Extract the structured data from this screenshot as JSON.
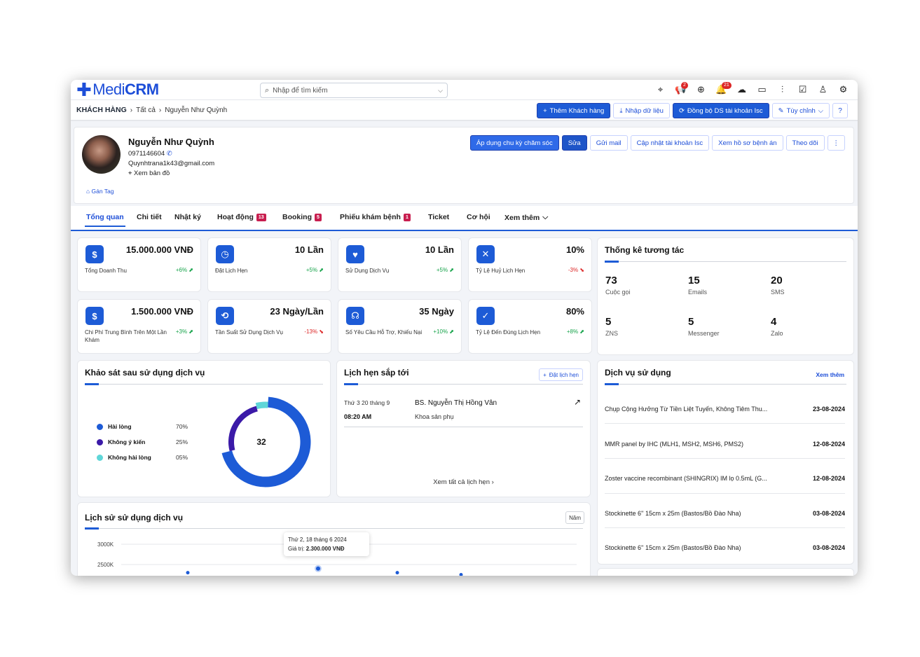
{
  "brand": {
    "logo_text_a": "Medi",
    "logo_text_b": "CRM",
    "accent": "#1d5bd6"
  },
  "search": {
    "placeholder": "Nhập để tìm kiếm"
  },
  "top_icons": [
    {
      "name": "location-icon",
      "badge": ""
    },
    {
      "name": "megaphone-icon",
      "badge": "2"
    },
    {
      "name": "plus-circle-icon",
      "badge": ""
    },
    {
      "name": "bell-icon",
      "badge": "21"
    },
    {
      "name": "cloud-icon",
      "badge": ""
    },
    {
      "name": "calendar-icon",
      "badge": ""
    },
    {
      "name": "chart-icon",
      "badge": ""
    },
    {
      "name": "checkbox-icon",
      "badge": ""
    },
    {
      "name": "user-icon",
      "badge": ""
    },
    {
      "name": "settings-icon",
      "badge": ""
    }
  ],
  "breadcrumb": {
    "root": "KHÁCH HÀNG",
    "level1": "Tất cả",
    "level2": "Nguyễn Như Quỳnh"
  },
  "subbar_actions": {
    "add": "Thêm Khách hàng",
    "import": "Nhập dữ liệu",
    "sync": "Đồng bộ DS tài khoản Isc",
    "custom": "Tùy chỉnh"
  },
  "profile": {
    "name": "Nguyễn Như Quỳnh",
    "phone": "0971146604",
    "email": "Quynhtrana1k43@gmail.com",
    "map": "Xem bản đồ",
    "tag": "Gán Tag",
    "actions": {
      "apply": "Áp dụng chu kỳ chăm sóc",
      "edit": "Sửa",
      "mail": "Gửi mail",
      "update": "Cập nhật tài khoản Isc",
      "records": "Xem hồ sơ bệnh án",
      "follow": "Theo dõi"
    }
  },
  "tabs": [
    {
      "label": "Tổng quan",
      "badge": ""
    },
    {
      "label": "Chi tiết",
      "badge": ""
    },
    {
      "label": "Nhật ký",
      "badge": ""
    },
    {
      "label": "Hoạt động",
      "badge": "13"
    },
    {
      "label": "Booking",
      "badge": "5"
    },
    {
      "label": "Phiếu khám bệnh",
      "badge": "1"
    },
    {
      "label": "Ticket",
      "badge": ""
    },
    {
      "label": "Cơ hội",
      "badge": ""
    },
    {
      "label": "Xem thêm",
      "badge": ""
    }
  ],
  "kpis": [
    {
      "icon": "money-bag-icon",
      "value": "15.000.000 VNĐ",
      "label": "Tổng Doanh Thu",
      "delta": "+6%",
      "dir": "up"
    },
    {
      "icon": "calendar-clock-icon",
      "value": "10 Lần",
      "label": "Đặt Lịch Hẹn",
      "delta": "+5%",
      "dir": "up"
    },
    {
      "icon": "heart-hand-icon",
      "value": "10 Lần",
      "label": "Sử Dụng Dịch Vụ",
      "delta": "+5%",
      "dir": "up"
    },
    {
      "icon": "calendar-x-icon",
      "value": "10%",
      "label": "Tỷ Lệ Huỷ Lịch Hẹn",
      "delta": "-3%",
      "dir": "down"
    },
    {
      "icon": "hand-coin-icon",
      "value": "1.500.000 VNĐ",
      "label": "Chi Phí Trung Bình Trên Một Lần Khám",
      "delta": "+3%",
      "dir": "up"
    },
    {
      "icon": "timer-icon",
      "value": "23 Ngày/Lần",
      "label": "Tần Suất Sử Dụng Dịch Vụ",
      "delta": "-13%",
      "dir": "down"
    },
    {
      "icon": "headset-icon",
      "value": "35 Ngày",
      "label": "Số Yêu Cầu Hỗ Trợ, Khiếu Nại",
      "delta": "+10%",
      "dir": "up"
    },
    {
      "icon": "calendar-check-icon",
      "value": "80%",
      "label": "Tỷ Lệ Đến Đúng Lịch Hẹn",
      "delta": "+8%",
      "dir": "up"
    }
  ],
  "interaction": {
    "title": "Thống kê tương tác",
    "stats": [
      {
        "value": "73",
        "label": "Cuộc gọi"
      },
      {
        "value": "15",
        "label": "Emails"
      },
      {
        "value": "20",
        "label": "SMS"
      },
      {
        "value": "5",
        "label": "ZNS"
      },
      {
        "value": "5",
        "label": "Messenger"
      },
      {
        "value": "4",
        "label": "Zalo"
      }
    ]
  },
  "survey": {
    "title": "Khảo sát sau sử dụng dịch vụ",
    "center": "32",
    "items": [
      {
        "label": "Hài lòng",
        "pct": "70%",
        "value": 70,
        "color": "#1d5bd6"
      },
      {
        "label": "Không ý kiến",
        "pct": "25%",
        "value": 25,
        "color": "#3b1aa8"
      },
      {
        "label": "Không hài lòng",
        "pct": "05%",
        "value": 5,
        "color": "#5fd6d8"
      }
    ]
  },
  "appointments": {
    "title": "Lịch hẹn sắp tới",
    "book": "Đặt lịch hẹn",
    "items": [
      {
        "date": "Thứ 3 20 tháng 9",
        "time": "08:20 AM",
        "doctor": "BS. Nguyễn Thị Hồng Vân",
        "dept": "Khoa sản phụ"
      }
    ],
    "view_all": "Xem tất cả lịch hẹn"
  },
  "services": {
    "title": "Dịch vụ sử dụng",
    "more": "Xem thêm",
    "items": [
      {
        "name": "Chụp Cộng Hưởng Từ Tiền Liệt Tuyến, Không Tiêm Thu...",
        "date": "23-08-2024"
      },
      {
        "name": "MMR panel by IHC (MLH1, MSH2, MSH6, PMS2)",
        "date": "12-08-2024"
      },
      {
        "name": "Zoster vaccine recombinant (SHINGRIX) IM lọ 0.5mL (G...",
        "date": "12-08-2024"
      },
      {
        "name": "Stockinette 6'' 15cm x 25m (Bastos/Bồ Đào Nha)",
        "date": "03-08-2024"
      },
      {
        "name": "Stockinette 6'' 15cm x 25m (Bastos/Bồ Đào Nha)",
        "date": "03-08-2024"
      }
    ]
  },
  "history": {
    "title": "Lịch sử sử dụng dịch vụ",
    "period": "Năm",
    "tooltip_date": "Thứ 2, 18 tháng 6 2024",
    "tooltip_label": "Giá trị:",
    "tooltip_value": "2.300.000 VNĐ"
  },
  "chart_data": {
    "type": "line",
    "yticks": [
      "3000K",
      "2500K"
    ],
    "ylim": [
      2500,
      3000
    ],
    "points": [
      {
        "y": 2300
      },
      {
        "y": 2400,
        "highlight": true
      },
      {
        "y": 2300
      },
      {
        "y": 2250
      }
    ]
  }
}
